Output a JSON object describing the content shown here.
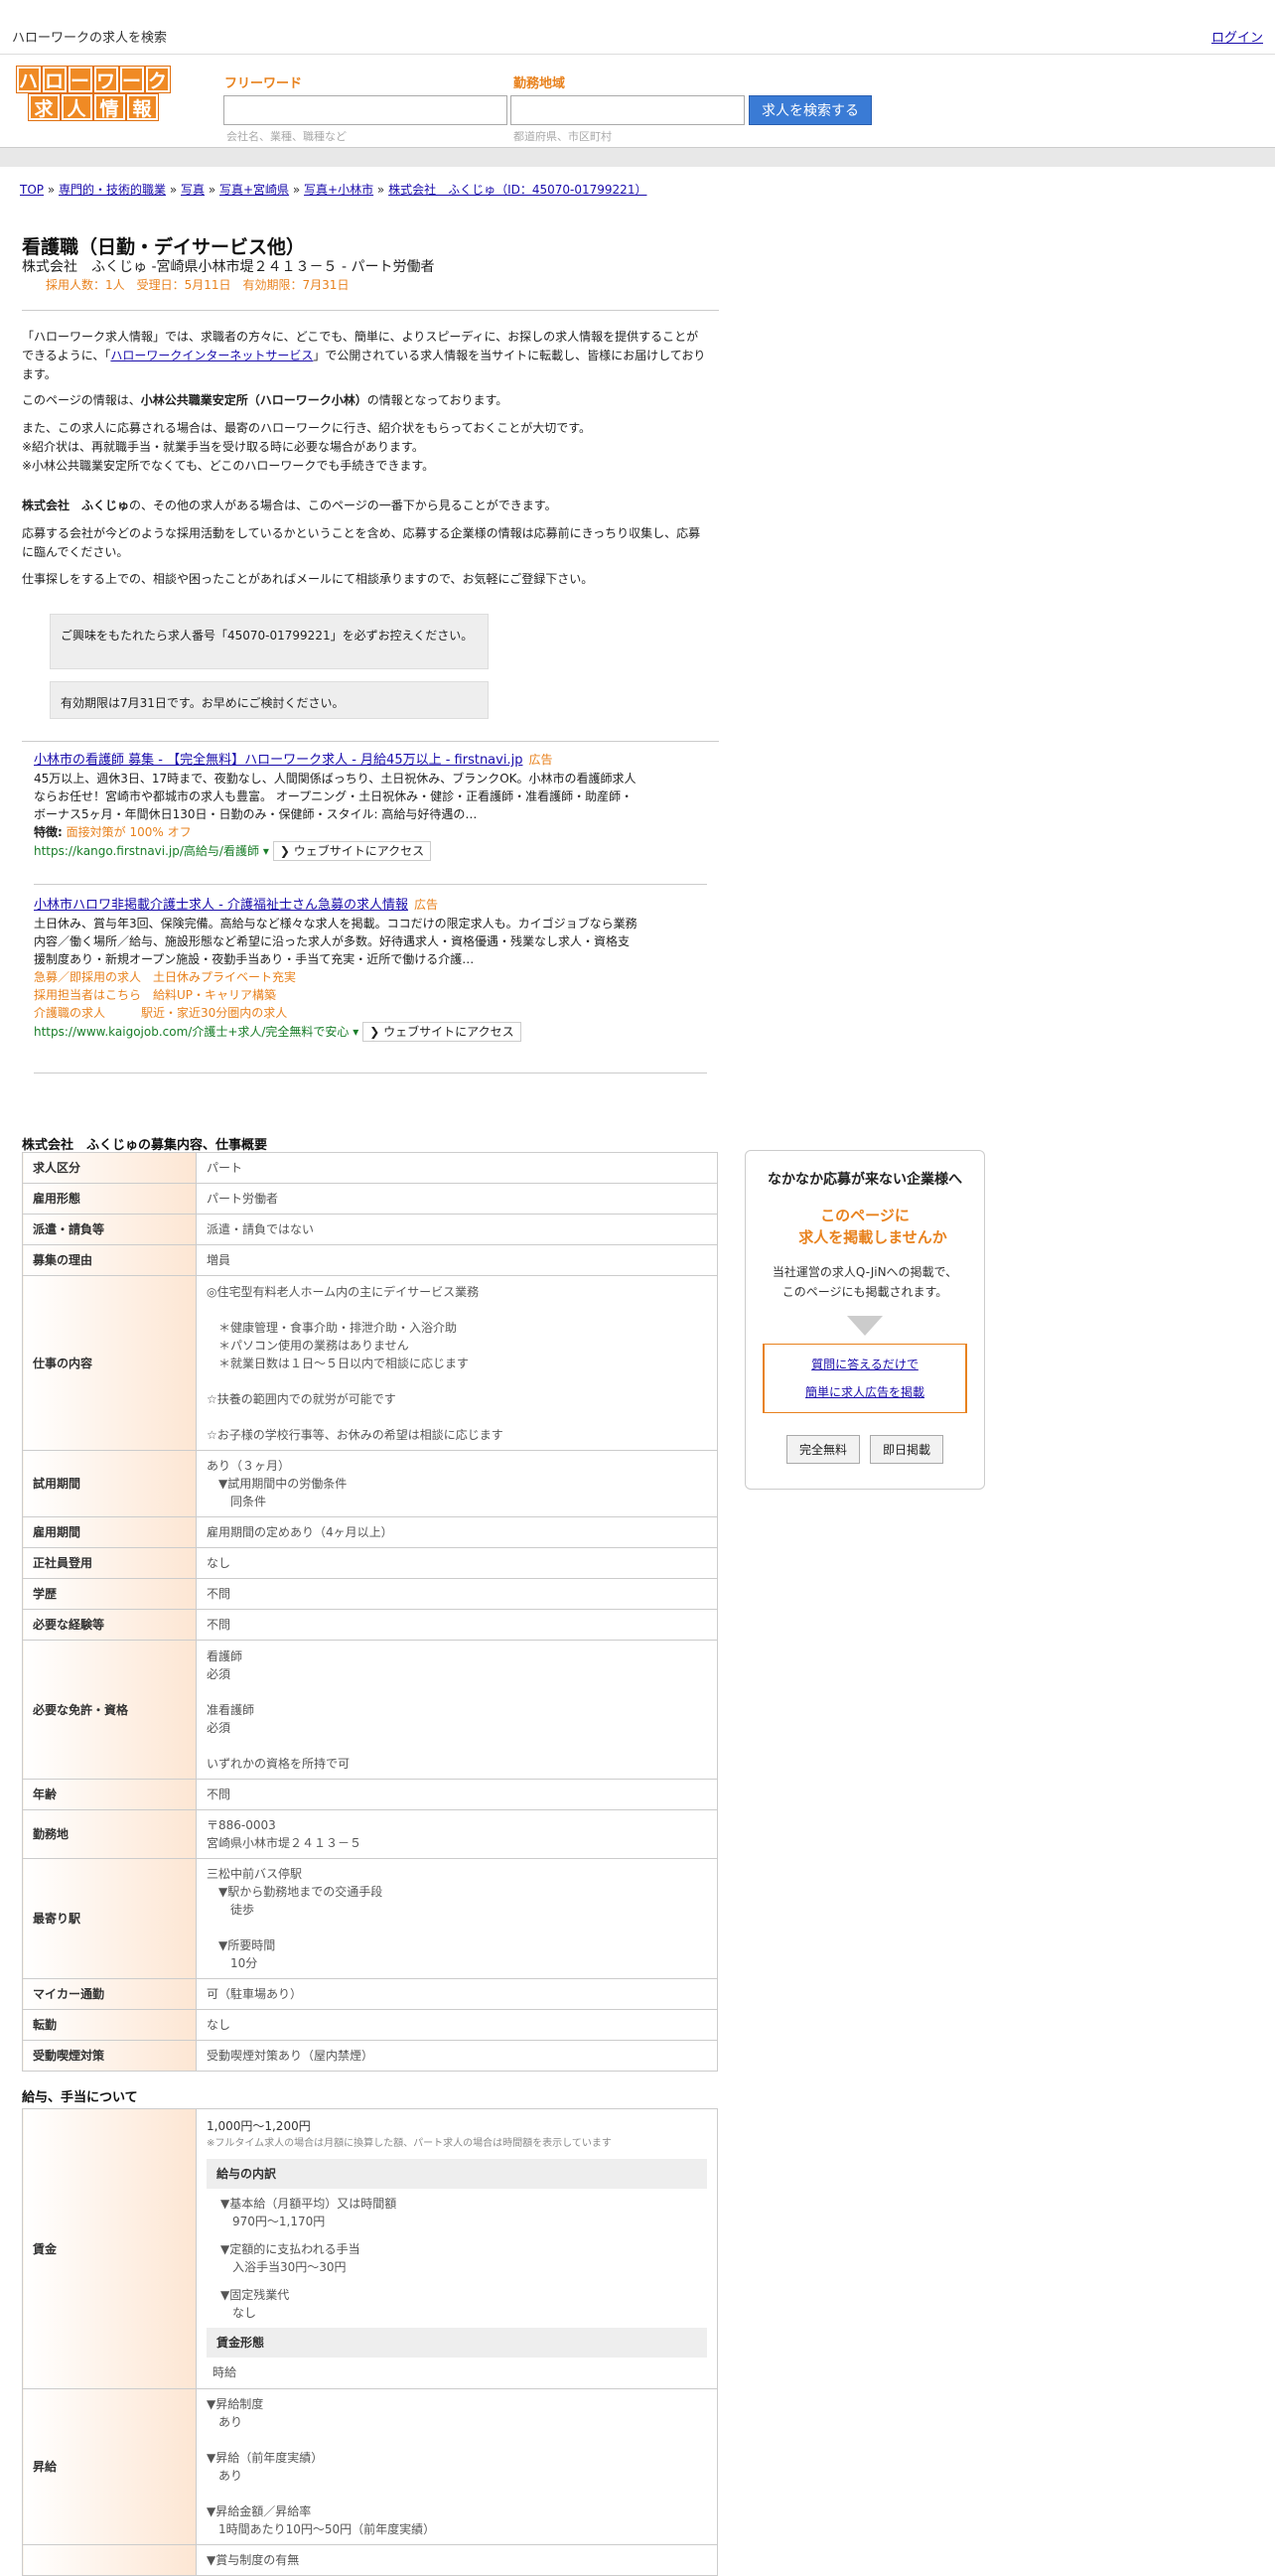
{
  "header": {
    "title": "ハローワークの求人を検索",
    "login": "ログイン"
  },
  "logo": {
    "row1": [
      "ハ",
      "ロ",
      "ー",
      "ワ",
      "ー",
      "ク"
    ],
    "row2": [
      "求",
      "人",
      "情",
      "報"
    ]
  },
  "search": {
    "kw_label": "フリーワード",
    "kw_hint": "会社名、業種、職種など",
    "area_label": "勤務地域",
    "area_hint": "都道府県、市区町村",
    "button": "求人を検索する"
  },
  "breadcrumb": [
    "TOP",
    "専門的・技術的職業",
    "写真",
    "写真+宮崎県",
    "写真+小林市",
    "株式会社　ふくじゅ（ID：45070-01799221）"
  ],
  "job": {
    "title": "看護職（日勤・デイサービス他）",
    "sub": "株式会社　ふくじゅ -宮崎県小林市堤２４１３－５ - パート労働者",
    "meta": "採用人数：1人　受理日：5月11日　有効期限：7月31日"
  },
  "intro": {
    "p1a": "「ハローワーク求人情報」では、求職者の方々に、どこでも、簡単に、よりスピーディに、お探しの求人情報を提供することができるように、「",
    "p1link": "ハローワークインターネットサービス",
    "p1b": "」で公開されている求人情報を当サイトに転載し、皆様にお届けしております。",
    "p2a": "このページの情報は、",
    "p2b": "小林公共職業安定所（ハローワーク小林）",
    "p2c": "の情報となっております。",
    "p3": "また、この求人に応募される場合は、最寄のハローワークに行き、紹介状をもらっておくことが大切です。",
    "p4": "※紹介状は、再就職手当・就業手当を受け取る時に必要な場合があります。",
    "p5": "※小林公共職業安定所でなくても、どこのハローワークでも手続きできます。",
    "p6a": "株式会社　ふくじゅ",
    "p6b": "の、その他の求人がある場合は、このページの一番下から見ることができます。",
    "p7": "応募する会社が今どのような採用活動をしているかということを含め、応募する企業様の情報は応募前にきっちり収集し、応募に臨んでください。",
    "p8": "仕事探しをする上での、相談や困ったことがあればメールにて相談承りますので、お気軽にご登録下さい。"
  },
  "notes": [
    "ご興味をもたれたら求人番号「45070-01799221」を必ずお控えください。",
    "有効期限は7月31日です。お早めにご検討ください。"
  ],
  "ads": [
    {
      "title": "小林市の看護師 募集 - 【完全無料】ハローワーク求人 - 月給45万以上 - firstnavi.jp",
      "tag": "広告",
      "desc": "45万以上、週休3日、17時まで、夜勤なし、人間関係ばっちり、土日祝休み、ブランクOK。小林市の看護師求人ならお任せ！宮崎市や都城市の求人も豊富。 オープニング・土日祝休み・健診・正看護師・准看護師・助産師・ボーナス5ヶ月・年間休日130日・日勤のみ・保健師・スタイル: 高給与好待遇の…",
      "feat_label": "特徴:",
      "feat": "面接対策が 100% オフ",
      "url": "https://kango.firstnavi.jp/高給与/看護師",
      "btn": "❯ ウェブサイトにアクセス"
    },
    {
      "title": "小林市ハロワ非掲載介護士求人 - 介護福祉士さん急募の求人情報",
      "tag": "広告",
      "desc": "土日休み、賞与年3回、保険完備。高給与など様々な求人を掲載。ココだけの限定求人も。カイゴジョブなら業務内容／働く場所／給与、施設形態など希望に沿った求人が多数。好待遇求人・資格優遇・残業なし求人・資格支援制度あり・新規オープン施設・夜勤手当あり・手当て充実・近所で働ける介護…",
      "links": [
        "急募／即採用の求人　土日休みプライベート充実",
        "採用担当者はこちら　給料UP・キャリア構築",
        "介護職の求人　　　駅近・家近30分圏内の求人"
      ],
      "url": "https://www.kaigojob.com/介護士+求人/完全無料で安心",
      "btn": "❯ ウェブサイトにアクセス"
    }
  ],
  "section1": "株式会社　ふくじゅの募集内容、仕事概要",
  "rows": [
    {
      "k": "求人区分",
      "v": "パート"
    },
    {
      "k": "雇用形態",
      "v": "パート労働者"
    },
    {
      "k": "派遣・請負等",
      "v": "派遣・請負ではない"
    },
    {
      "k": "募集の理由",
      "v": "増員"
    },
    {
      "k": "仕事の内容",
      "v": "◎住宅型有料老人ホーム内の主にデイサービス業務\n\n　＊健康管理・食事介助・排泄介助・入浴介助\n　＊パソコン使用の業務はありません\n　＊就業日数は１日～５日以内で相談に応じます\n\n☆扶養の範囲内での就労が可能です\n\n☆お子様の学校行事等、お休みの希望は相談に応じます"
    },
    {
      "k": "試用期間",
      "v": "あり（３ヶ月）\n　▼試用期間中の労働条件\n　　同条件"
    },
    {
      "k": "雇用期間",
      "v": "雇用期間の定めあり（4ヶ月以上）"
    },
    {
      "k": "正社員登用",
      "v": "なし"
    },
    {
      "k": "学歴",
      "v": "不問"
    },
    {
      "k": "必要な経験等",
      "v": "不問"
    },
    {
      "k": "必要な免許・資格",
      "v": "看護師\n必須\n\n准看護師\n必須\n\nいずれかの資格を所持で可"
    },
    {
      "k": "年齢",
      "v": "不問"
    },
    {
      "k": "勤務地",
      "v": "〒886-0003\n宮崎県小林市堤２４１３－５"
    },
    {
      "k": "最寄り駅",
      "v": "三松中前バス停駅\n　▼駅から勤務地までの交通手段\n　　徒歩\n\n　▼所要時間\n　　10分"
    },
    {
      "k": "マイカー通勤",
      "v": "可（駐車場あり）"
    },
    {
      "k": "転勤",
      "v": "なし"
    },
    {
      "k": "受動喫煙対策",
      "v": "受動喫煙対策あり（屋内禁煙）"
    }
  ],
  "side": {
    "h": "なかなか応募が来ない企業様へ",
    "o1": "このページに",
    "o2": "求人を掲載しませんか",
    "p1": "当社運営の求人Q-JiNへの掲載で、",
    "p2": "このページにも掲載されます。",
    "l1": "質問に答えるだけで",
    "l2": "簡単に求人広告を掲載",
    "b1": "完全無料",
    "b2": "即日掲載"
  },
  "section2": "給与、手当について",
  "wage": {
    "k": "賃金",
    "amount": "1,000円〜1,200円",
    "note": "※フルタイム求人の場合は月額に換算した額、パート求人の場合は時間額を表示しています",
    "sub1": "給与の内訳",
    "i1": "▼基本給（月額平均）又は時間額\n　970円〜1,170円",
    "i2": "▼定額的に支払われる手当\n　入浴手当30円〜30円",
    "i3": "▼固定残業代\n　なし",
    "sub2": "賃金形態",
    "form": "時給"
  },
  "raise": {
    "k": "昇給",
    "v": "▼昇給制度\n　あり\n\n▼昇給（前年度実績）\n　あり\n\n▼昇給金額／昇給率\n　1時間あたり10円〜50円（前年度実績）"
  },
  "bonus": {
    "v": "▼賞与制度の有無"
  }
}
